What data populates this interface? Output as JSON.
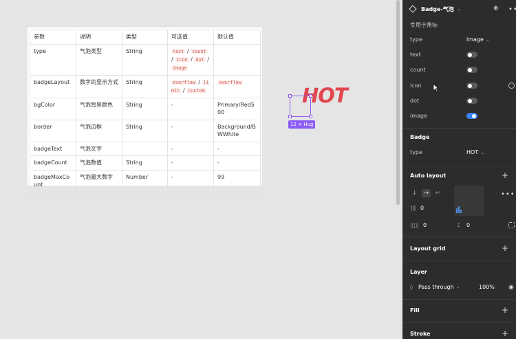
{
  "table": {
    "headers": [
      "参数",
      "说明",
      "类型",
      "可选值",
      "默认值"
    ],
    "rows": [
      {
        "param": "type",
        "desc": "气泡类型",
        "type": "String",
        "options": [
          "text",
          "count",
          "icon",
          "dot",
          "image"
        ],
        "default": ""
      },
      {
        "param": "badgeLayout",
        "desc": "数字的显示方式",
        "type": "String",
        "options": [
          "overflow",
          "limit",
          "custom"
        ],
        "default_code": "overflow"
      },
      {
        "param": "bgColor",
        "desc": "气泡背景颜色",
        "type": "String",
        "options_text": "-",
        "default": "Primary/Red500"
      },
      {
        "param": "border",
        "desc": "气泡边框",
        "type": "String",
        "options_text": "-",
        "default": "Background/BWWhite"
      },
      {
        "param": "badgeText",
        "desc": "气泡文字",
        "type": "",
        "options_text": "-",
        "default": "-"
      },
      {
        "param": "badgeCount",
        "desc": "气泡数值",
        "type": "String",
        "options_text": "-",
        "default": "-"
      },
      {
        "param": "badgeMaxCount",
        "desc": "气泡最大数字",
        "type": "Number",
        "options_text": "-",
        "default": "99"
      }
    ]
  },
  "canvas": {
    "hot_text": "HOT",
    "size_badge": "12 × Hug"
  },
  "panel": {
    "component_name": "Badge-气泡",
    "description": "专用于角标",
    "props": {
      "type_label": "type",
      "type_value": "image",
      "text_label": "text",
      "text_on": false,
      "count_label": "count",
      "count_on": false,
      "icon_label": "icon",
      "icon_on": false,
      "dot_label": "dot",
      "dot_on": false,
      "image_label": "image",
      "image_on": true
    },
    "badge_section": {
      "title": "Badge",
      "type_label": "type",
      "type_value": "HOT"
    },
    "auto_layout": {
      "title": "Auto layout",
      "spacing": "0",
      "padding_h": "0",
      "padding_v": "0"
    },
    "layout_grid": {
      "title": "Layout grid"
    },
    "layer": {
      "title": "Layer",
      "blend": "Pass through",
      "opacity": "100%"
    },
    "fill": {
      "title": "Fill"
    },
    "stroke": {
      "title": "Stroke"
    }
  },
  "colors": {
    "accent": "#8b5cf6",
    "hot": "#e2464f",
    "toggle_on": "#3b82f6"
  }
}
